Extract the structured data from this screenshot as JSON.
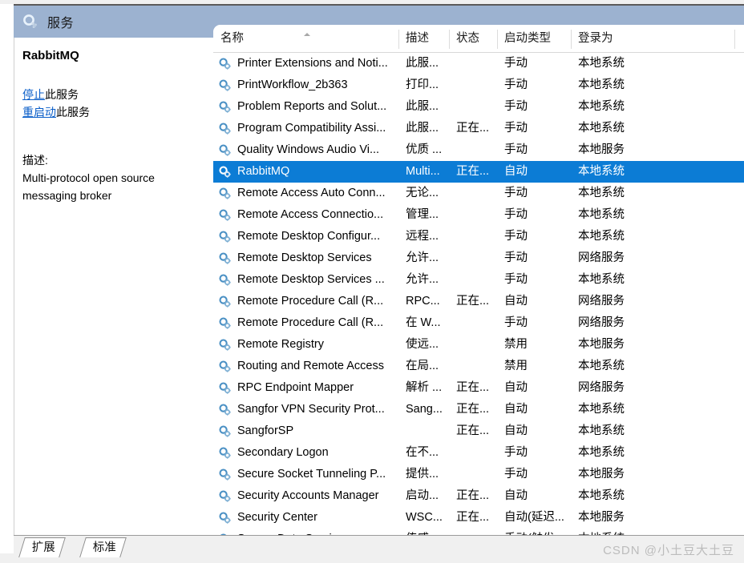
{
  "window": {
    "title": "服务",
    "title_icon": "service-gear-icon"
  },
  "details_pane": {
    "service_name": "RabbitMQ",
    "links": [
      {
        "link_text": "停止",
        "suffix": "此服务"
      },
      {
        "link_text": "重启动",
        "suffix": "此服务"
      }
    ],
    "description_label": "描述:",
    "description_text": "Multi-protocol open source messaging broker"
  },
  "list": {
    "sort_indicator": "ascending",
    "columns": [
      {
        "key": "name",
        "label": "名称"
      },
      {
        "key": "desc",
        "label": "描述"
      },
      {
        "key": "status",
        "label": "状态"
      },
      {
        "key": "startup",
        "label": "启动类型"
      },
      {
        "key": "logon",
        "label": "登录为"
      }
    ],
    "rows": [
      {
        "name": "Printer Extensions and Noti...",
        "desc": "此服...",
        "status": "",
        "startup": "手动",
        "logon": "本地系统",
        "selected": false
      },
      {
        "name": "PrintWorkflow_2b363",
        "desc": "打印...",
        "status": "",
        "startup": "手动",
        "logon": "本地系统",
        "selected": false
      },
      {
        "name": "Problem Reports and Solut...",
        "desc": "此服...",
        "status": "",
        "startup": "手动",
        "logon": "本地系统",
        "selected": false
      },
      {
        "name": "Program Compatibility Assi...",
        "desc": "此服...",
        "status": "正在...",
        "startup": "手动",
        "logon": "本地系统",
        "selected": false
      },
      {
        "name": "Quality Windows Audio Vi...",
        "desc": "优质 ...",
        "status": "",
        "startup": "手动",
        "logon": "本地服务",
        "selected": false
      },
      {
        "name": "RabbitMQ",
        "desc": "Multi...",
        "status": "正在...",
        "startup": "自动",
        "logon": "本地系统",
        "selected": true
      },
      {
        "name": "Remote Access Auto Conn...",
        "desc": "无论...",
        "status": "",
        "startup": "手动",
        "logon": "本地系统",
        "selected": false
      },
      {
        "name": "Remote Access Connectio...",
        "desc": "管理...",
        "status": "",
        "startup": "手动",
        "logon": "本地系统",
        "selected": false
      },
      {
        "name": "Remote Desktop Configur...",
        "desc": "远程...",
        "status": "",
        "startup": "手动",
        "logon": "本地系统",
        "selected": false
      },
      {
        "name": "Remote Desktop Services",
        "desc": "允许...",
        "status": "",
        "startup": "手动",
        "logon": "网络服务",
        "selected": false
      },
      {
        "name": "Remote Desktop Services ...",
        "desc": "允许...",
        "status": "",
        "startup": "手动",
        "logon": "本地系统",
        "selected": false
      },
      {
        "name": "Remote Procedure Call (R...",
        "desc": "RPC...",
        "status": "正在...",
        "startup": "自动",
        "logon": "网络服务",
        "selected": false
      },
      {
        "name": "Remote Procedure Call (R...",
        "desc": "在 W...",
        "status": "",
        "startup": "手动",
        "logon": "网络服务",
        "selected": false
      },
      {
        "name": "Remote Registry",
        "desc": "使远...",
        "status": "",
        "startup": "禁用",
        "logon": "本地服务",
        "selected": false
      },
      {
        "name": "Routing and Remote Access",
        "desc": "在局...",
        "status": "",
        "startup": "禁用",
        "logon": "本地系统",
        "selected": false
      },
      {
        "name": "RPC Endpoint Mapper",
        "desc": "解析 ...",
        "status": "正在...",
        "startup": "自动",
        "logon": "网络服务",
        "selected": false
      },
      {
        "name": "Sangfor VPN Security Prot...",
        "desc": "Sang...",
        "status": "正在...",
        "startup": "自动",
        "logon": "本地系统",
        "selected": false
      },
      {
        "name": "SangforSP",
        "desc": "",
        "status": "正在...",
        "startup": "自动",
        "logon": "本地系统",
        "selected": false
      },
      {
        "name": "Secondary Logon",
        "desc": "在不...",
        "status": "",
        "startup": "手动",
        "logon": "本地系统",
        "selected": false
      },
      {
        "name": "Secure Socket Tunneling P...",
        "desc": "提供...",
        "status": "",
        "startup": "手动",
        "logon": "本地服务",
        "selected": false
      },
      {
        "name": "Security Accounts Manager",
        "desc": "启动...",
        "status": "正在...",
        "startup": "自动",
        "logon": "本地系统",
        "selected": false
      },
      {
        "name": "Security Center",
        "desc": "WSC...",
        "status": "正在...",
        "startup": "自动(延迟...",
        "logon": "本地服务",
        "selected": false
      },
      {
        "name": "Sensor Data Service",
        "desc": "传感...",
        "status": "",
        "startup": "手动(触发...",
        "logon": "本地系统",
        "selected": false
      }
    ]
  },
  "tabs": [
    {
      "label": "扩展"
    },
    {
      "label": "标准"
    }
  ],
  "watermark": "CSDN @小土豆大土豆",
  "colors": {
    "titlebar": "#9cb2d0",
    "selection": "#0c7cd5",
    "hyperlink": "#0a5ec9",
    "page_background": "#f0f0f0"
  }
}
